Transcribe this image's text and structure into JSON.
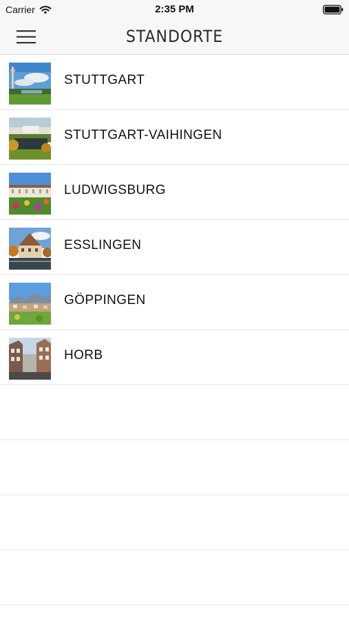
{
  "status_bar": {
    "carrier": "Carrier",
    "time": "2:35 PM",
    "wifi_icon": "wifi-icon",
    "battery_icon": "battery-full-icon"
  },
  "nav": {
    "title": "STANDORTE",
    "menu_icon": "hamburger-menu-icon"
  },
  "locations": [
    {
      "name": "STUTTGART",
      "thumbnail": "stuttgart-photo"
    },
    {
      "name": "STUTTGART-VAIHINGEN",
      "thumbnail": "stuttgart-vaihingen-photo"
    },
    {
      "name": "LUDWIGSBURG",
      "thumbnail": "ludwigsburg-photo"
    },
    {
      "name": "ESSLINGEN",
      "thumbnail": "esslingen-photo"
    },
    {
      "name": "GÖPPINGEN",
      "thumbnail": "goeppingen-photo"
    },
    {
      "name": "HORB",
      "thumbnail": "horb-photo"
    }
  ],
  "colors": {
    "bar_background": "#f7f7f7",
    "separator": "#e6e6e6",
    "text": "#111111"
  }
}
